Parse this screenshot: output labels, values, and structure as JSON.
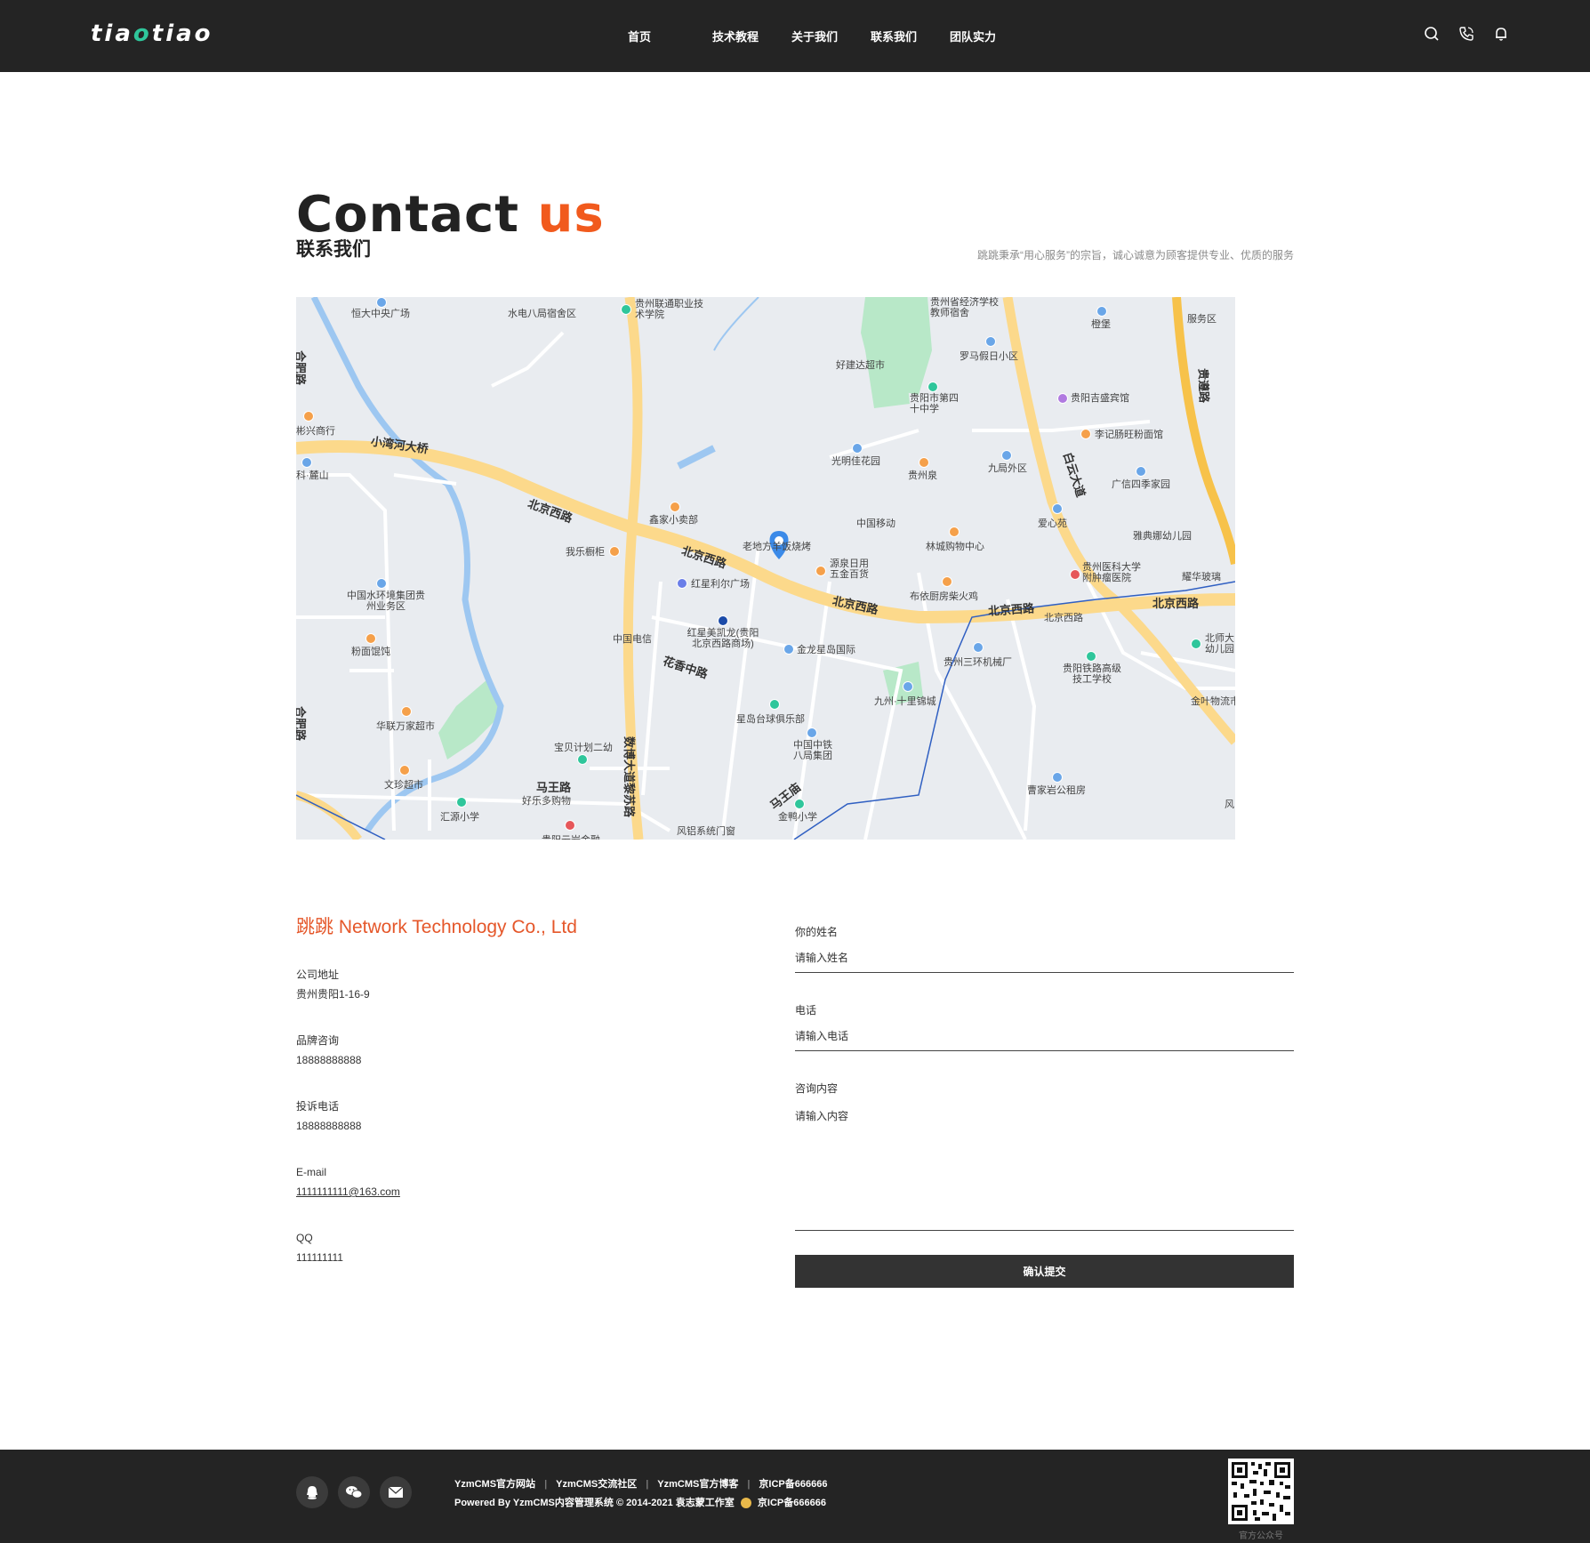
{
  "header": {
    "logo": "tiaotiao",
    "nav": [
      "首页",
      "技术教程",
      "关于我们",
      "联系我们",
      "团队实力"
    ],
    "icons": [
      "search-icon",
      "phone-icon",
      "bell-icon"
    ]
  },
  "title": {
    "en_main": "Contact ",
    "en_accent": "us",
    "cn": "联系我们",
    "slogan": "跳跳秉承“用心服务”的宗旨，诚心诚意为顾客提供专业、优质的服务"
  },
  "map": {
    "roads": [
      "小湾河大桥",
      "北京西路",
      "北京西路",
      "北京西路",
      "北京西路",
      "北京西路",
      "白云大道",
      "贵遵路",
      "数博大道黎苏路",
      "花香中路",
      "马王路",
      "马王庙",
      "合肥路",
      "合肥路"
    ],
    "labels": [
      "恒大中央广场",
      "水电八局宿舍区",
      "贵州联通职业技术学院",
      "贵州省经济学校教师宿舍",
      "橙堡",
      "服务区",
      "好建达超市",
      "罗马假日小区",
      "贵阳市第四十中学",
      "贵阳吉盛宾馆",
      "彬兴商行",
      "李记肠旺粉面馆",
      "光明佳花园",
      "贵州泉",
      "九局外区",
      "广信四季家园",
      "科·麓山",
      "鑫家小卖部",
      "中国移动",
      "爱心苑",
      "雅典娜幼儿园",
      "我乐橱柜",
      "老地方羊饭烧烤",
      "林城购物中心",
      "源泉日用五金百货",
      "贵州医科大学附肿瘤医院",
      "耀华玻璃",
      "中国水环境集团贵州业务区",
      "红星利尔广场",
      "布依厨房柴火鸡",
      "北京西路",
      "粉面馄饨",
      "中国电信",
      "红星美凯龙(贵阳北京西路商场)",
      "金龙星岛国际",
      "贵州三环机械厂",
      "贵阳铁路高级技工学校",
      "北师大幼儿园",
      "九州·十里锦城",
      "金叶物流市",
      "华联万家超市",
      "星岛台球俱乐部",
      "宝贝计划二幼",
      "中国中铁八局集团",
      "文珍超市",
      "好乐多购物",
      "汇源小学",
      "金鸭小学",
      "曹家岩公租房",
      "风铝系统门窗",
      "贵阳云岩金融",
      "风"
    ]
  },
  "company": {
    "name": "跳跳 Network Technology Co., Ltd",
    "items": [
      {
        "key": "公司地址",
        "value": "贵州贵阳1-16-9"
      },
      {
        "key": "品牌咨询",
        "value": "18888888888"
      },
      {
        "key": "投诉电话",
        "value": "18888888888"
      },
      {
        "key": "E-mail",
        "value": "1111111111@163.com"
      },
      {
        "key": "QQ",
        "value": "111111111"
      }
    ]
  },
  "form": {
    "name_label": "你的姓名",
    "name_placeholder": "请输入姓名",
    "phone_label": "电话",
    "phone_placeholder": "请输入电话",
    "content_label": "咨询内容",
    "content_placeholder": "请输入内容",
    "submit": "确认提交"
  },
  "footer": {
    "icons": [
      "qq-icon",
      "wechat-icon",
      "mail-icon"
    ],
    "links": [
      "YzmCMS官方网站",
      "YzmCMS交流社区",
      "YzmCMS官方博客",
      "京ICP备666666"
    ],
    "powered": "Powered By YzmCMS内容管理系统 © 2014-2021 袁志蒙工作室",
    "icp2": "京ICP备666666",
    "qr_label": "官方公众号"
  },
  "colors": {
    "accent": "#f15a1d",
    "dark": "#242424",
    "logo_green": "#2fc69b"
  }
}
